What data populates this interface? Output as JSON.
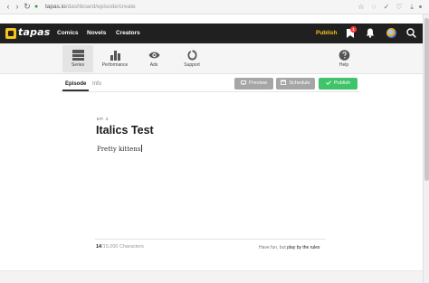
{
  "browser": {
    "url_host": "tapas.io",
    "url_path": "/dashboard/episode/create"
  },
  "topnav": {
    "logo_text": "tapas",
    "links": [
      "Comics",
      "Novels",
      "Creators"
    ],
    "publish_label": "Publish",
    "notification_count": "1"
  },
  "toolbar": {
    "items": [
      {
        "label": "Series",
        "icon": "series-icon",
        "active": true
      },
      {
        "label": "Performance",
        "icon": "bar-chart-icon",
        "active": false
      },
      {
        "label": "Ads",
        "icon": "eye-icon",
        "active": false
      },
      {
        "label": "Support",
        "icon": "support-icon",
        "active": false
      },
      {
        "label": "Help",
        "icon": "help-icon",
        "active": false
      }
    ]
  },
  "tabs": {
    "episode": "Episode",
    "info": "Info"
  },
  "actions": {
    "preview": "Preview",
    "schedule": "Schedule",
    "publish": "Publish"
  },
  "editor": {
    "episode_label": "EP. 4",
    "title": "Italics Test",
    "body": "Pretty kittens"
  },
  "footer": {
    "count": "14",
    "count_suffix": "/15,000 Characters",
    "rules_prefix": "Have fun, but ",
    "rules_link": "play by the rules"
  },
  "colors": {
    "nav_bg": "#202020",
    "brand_yellow": "#f7c21e",
    "publish_green": "#3fc46a",
    "button_gray": "#a6a6a6"
  }
}
